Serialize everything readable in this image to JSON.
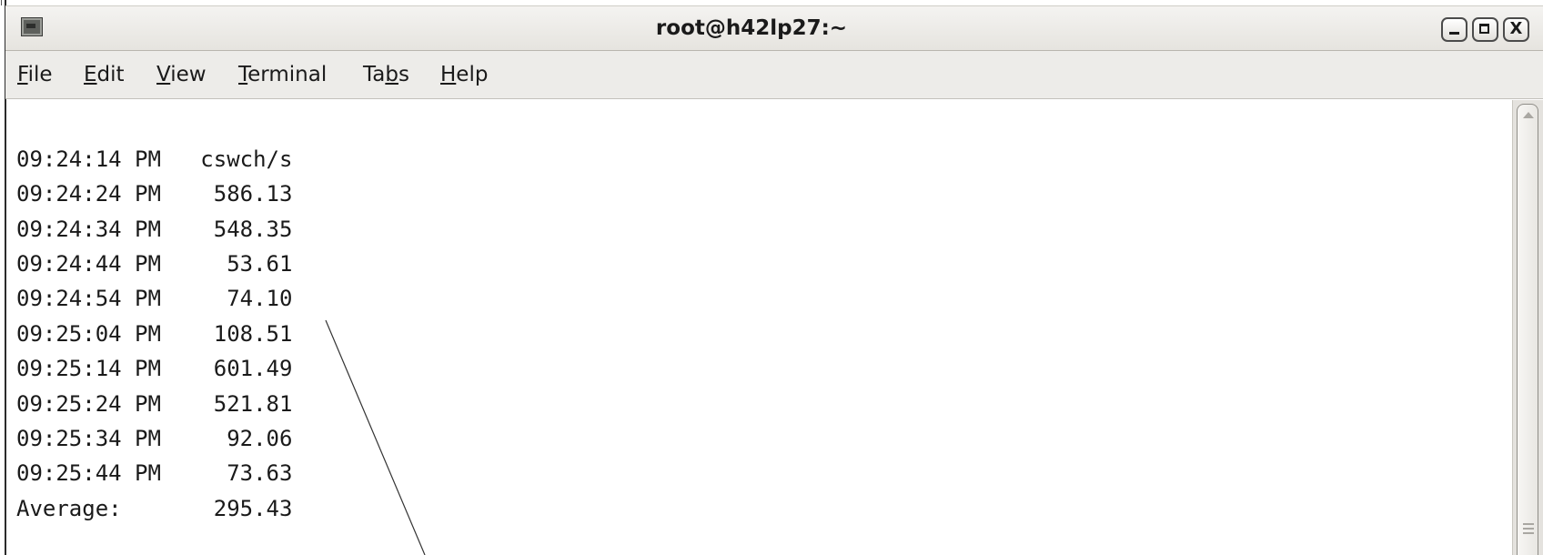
{
  "window": {
    "title": "root@h42lp27:~",
    "icon": "terminal-icon",
    "controls": {
      "minimize": "minimize-icon",
      "maximize": "maximize-icon",
      "close": "close-icon",
      "close_glyph": "X"
    }
  },
  "menubar": {
    "items": [
      {
        "pre": "",
        "u": "F",
        "post": "ile"
      },
      {
        "pre": "",
        "u": "E",
        "post": "dit"
      },
      {
        "pre": "",
        "u": "V",
        "post": "iew"
      },
      {
        "pre": "",
        "u": "T",
        "post": "erminal"
      },
      {
        "pre": "Ta",
        "u": "b",
        "post": "s"
      },
      {
        "pre": "",
        "u": "H",
        "post": "elp"
      }
    ]
  },
  "terminal": {
    "lines": [
      "09:24:14 PM   cswch/s",
      "09:24:24 PM    586.13",
      "09:24:34 PM    548.35",
      "09:24:44 PM     53.61",
      "09:24:54 PM     74.10",
      "09:25:04 PM    108.51",
      "09:25:14 PM    601.49",
      "09:25:24 PM    521.81",
      "09:25:34 PM     92.06",
      "09:25:44 PM     73.63",
      "Average:       295.43"
    ]
  },
  "colors": {
    "text": "#1a1a1a",
    "titlebar": "#e6e4df",
    "menubar": "#edece9",
    "background": "#ffffff"
  }
}
